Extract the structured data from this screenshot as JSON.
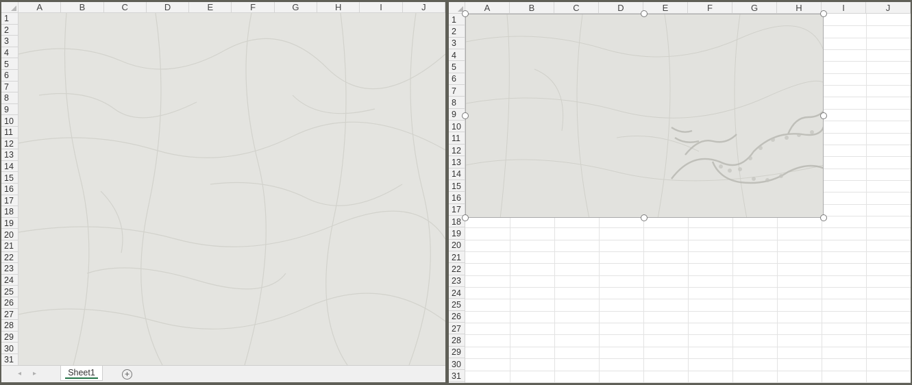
{
  "left_pane": {
    "columns": [
      "A",
      "B",
      "C",
      "D",
      "E",
      "F",
      "G",
      "H",
      "I",
      "J"
    ],
    "rows": [
      "1",
      "2",
      "3",
      "4",
      "5",
      "6",
      "7",
      "8",
      "9",
      "10",
      "11",
      "12",
      "13",
      "14",
      "15",
      "16",
      "17",
      "18",
      "19",
      "20",
      "21",
      "22",
      "23",
      "24",
      "25",
      "26",
      "27",
      "28",
      "29",
      "30",
      "31"
    ],
    "background_image": "crackle-glaze-texture",
    "sheet_tab": "Sheet1",
    "add_sheet_icon": "plus-circle-icon",
    "nav_prev_icon": "arrow-left-icon",
    "nav_next_icon": "arrow-right-icon"
  },
  "right_pane": {
    "columns": [
      "A",
      "B",
      "C",
      "D",
      "E",
      "F",
      "G",
      "H",
      "I",
      "J"
    ],
    "rows": [
      "1",
      "2",
      "3",
      "4",
      "5",
      "6",
      "7",
      "8",
      "9",
      "10",
      "11",
      "12",
      "13",
      "14",
      "15",
      "16",
      "17",
      "18",
      "19",
      "20",
      "21",
      "22",
      "23",
      "24",
      "25",
      "26",
      "27",
      "28",
      "29",
      "30",
      "31"
    ],
    "picture": "crackle-glaze-dragon-image"
  },
  "colors": {
    "header_bg": "#f2f2f2",
    "gridline": "#e3e3e3",
    "texture": "#e4e4e0",
    "window_frame": "#5f5f57"
  }
}
